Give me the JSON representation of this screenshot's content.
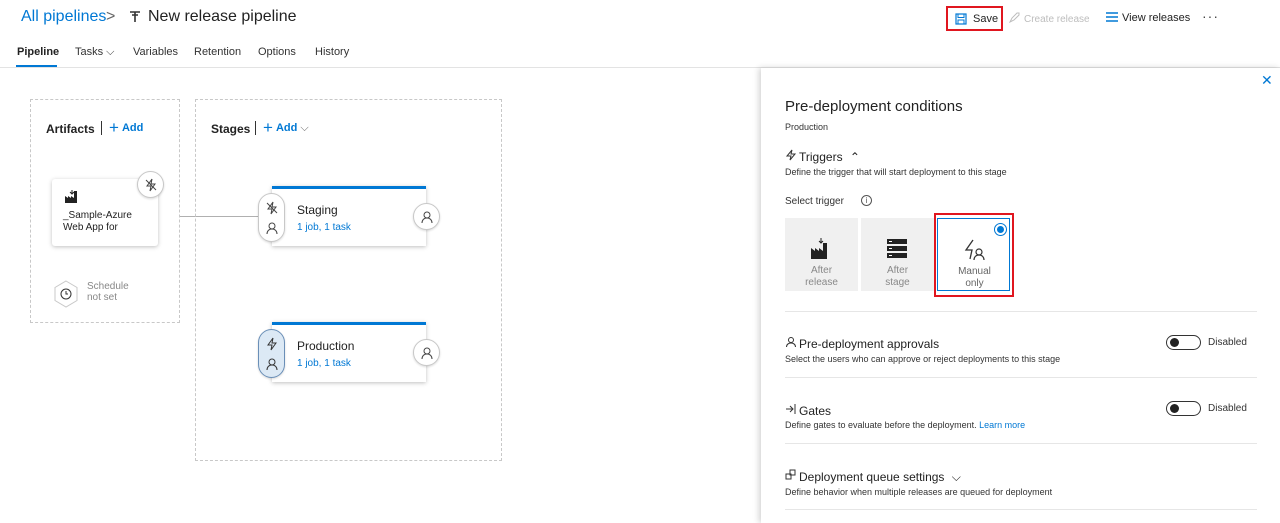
{
  "header": {
    "breadcrumb": "All pipelines",
    "separator": ">",
    "title": "New release pipeline",
    "save_label": "Save",
    "create_release_label": "Create release",
    "view_releases_label": "View releases",
    "more_label": "···"
  },
  "tabs": [
    {
      "label": "Pipeline",
      "active": true
    },
    {
      "label": "Tasks ⌵"
    },
    {
      "label": "Variables"
    },
    {
      "label": "Retention"
    },
    {
      "label": "Options"
    },
    {
      "label": "History"
    }
  ],
  "artifacts": {
    "title": "Artifacts",
    "add_label": "Add",
    "artifact_name_line1": "_Sample-Azure",
    "artifact_name_line2": "Web App for",
    "schedule_line1": "Schedule",
    "schedule_line2": "not set"
  },
  "stages": {
    "title": "Stages",
    "add_label": "Add",
    "items": [
      {
        "name": "Staging",
        "sub": "1 job, 1 task"
      },
      {
        "name": "Production",
        "sub": "1 job, 1 task"
      }
    ]
  },
  "panel": {
    "close_label": "✕",
    "title": "Pre-deployment conditions",
    "subtitle": "Production",
    "triggers_label": "Triggers",
    "triggers_desc": "Define the trigger that will start deployment to this stage",
    "select_trigger_label": "Select trigger",
    "trigger_options": [
      {
        "line1": "After",
        "line2": "release"
      },
      {
        "line1": "After",
        "line2": "stage"
      },
      {
        "line1": "Manual",
        "line2": "only",
        "selected": true
      }
    ],
    "approvals_label": "Pre-deployment approvals",
    "approvals_desc": "Select the users who can approve or reject deployments to this stage",
    "approvals_state": "Disabled",
    "gates_label": "Gates",
    "gates_desc": "Define gates to evaluate before the deployment.",
    "gates_learn_more": "Learn more",
    "gates_state": "Disabled",
    "queue_label": "Deployment queue settings",
    "queue_desc": "Define behavior when multiple releases are queued for deployment"
  },
  "colors": {
    "accent": "#0078d4",
    "highlight": "#e0161f"
  }
}
